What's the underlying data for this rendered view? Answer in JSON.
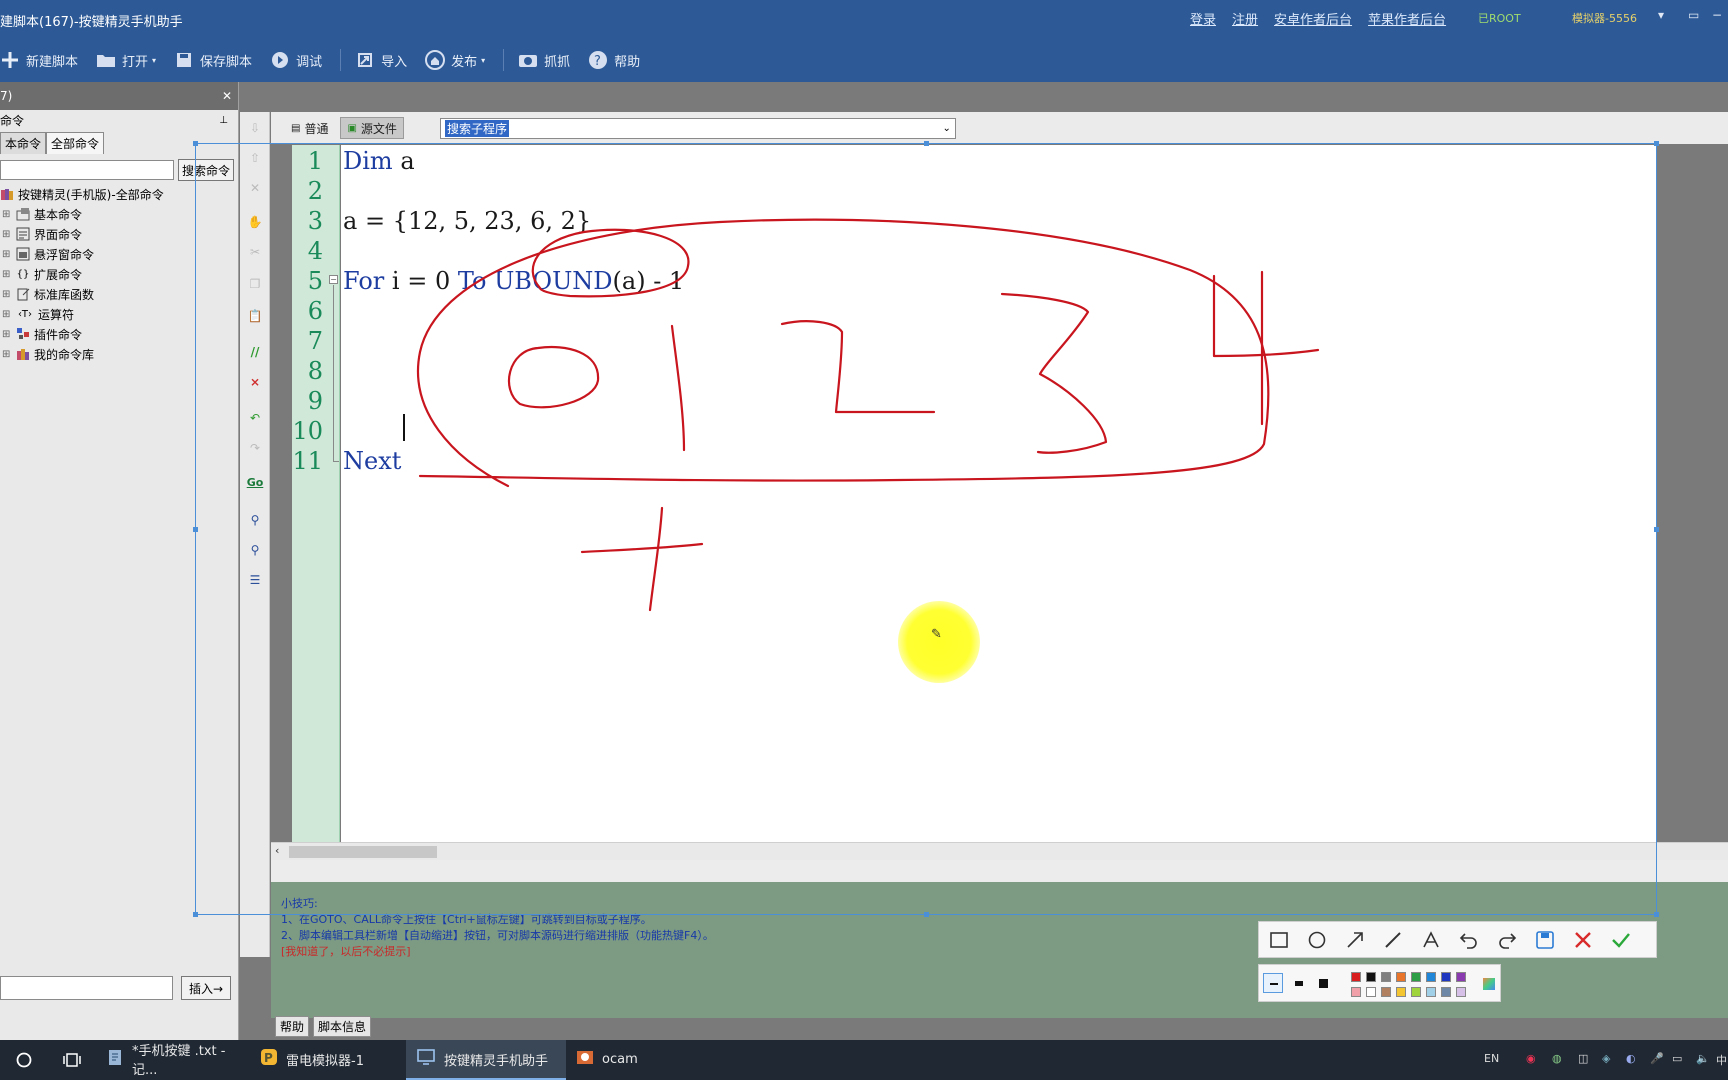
{
  "window": {
    "title": "建脚本(167)-按键精灵手机助手",
    "links": [
      "登录",
      "注册",
      "安卓作者后台",
      "苹果作者后台"
    ],
    "status": "已ROOT",
    "emulator": "模拟器-5556"
  },
  "toolbar": {
    "new": "新建脚本",
    "open": "打开",
    "save": "保存脚本",
    "debug": "调试",
    "import": "导入",
    "publish": "发布",
    "capture": "抓抓",
    "help": "帮助"
  },
  "left": {
    "tab_label": "7)",
    "header": "命令",
    "tabs": [
      "本命令",
      "全部命令"
    ],
    "search_button": "搜索命令",
    "tree": [
      {
        "label": "按键精灵(手机版)-全部命令",
        "icon": "books-icon"
      },
      {
        "label": "基本命令",
        "icon": "cmd-icon"
      },
      {
        "label": "界面命令",
        "icon": "ui-icon"
      },
      {
        "label": "悬浮窗命令",
        "icon": "window-icon"
      },
      {
        "label": "扩展命令",
        "icon": "braces-icon"
      },
      {
        "label": "标准库函数",
        "icon": "lib-icon"
      },
      {
        "label": "运算符",
        "icon": "operator-icon"
      },
      {
        "label": "插件命令",
        "icon": "plugin-icon"
      },
      {
        "label": "我的命令库",
        "icon": "mylib-icon"
      }
    ],
    "insert_button": "插入→"
  },
  "editor": {
    "mode_normal": "普通",
    "mode_source": "源文件",
    "sub_select": "搜索子程序",
    "line_numbers": [
      "1",
      "2",
      "3",
      "4",
      "5",
      "6",
      "7",
      "8",
      "9",
      "10",
      "11"
    ],
    "code": {
      "l1_kw": "Dim",
      "l1_rest": " a",
      "l3": "a = {12, 5, 23, 6, 2}",
      "l5_kw1": "For",
      "l5_mid": " i = 0 ",
      "l5_kw2": "To",
      "l5_sp": " ",
      "l5_kw3": "UBOUND",
      "l5_rest": "(a) - 1",
      "l11_kw": "Next"
    }
  },
  "tips": {
    "title": "小技巧:",
    "tip1": "1、在GOTO、CALL命令上按住【Ctrl+鼠标左键】可跳转到目标或子程序。",
    "tip2": "2、脚本编辑工具栏新增【自动缩进】按钮，可对脚本源码进行缩进排版（功能热键F4）。",
    "dismiss": "[我知道了，以后不必提示]"
  },
  "bottom_tabs": [
    "帮助",
    "脚本信息"
  ],
  "annotation_tools": [
    "rect-icon",
    "ellipse-icon",
    "arrow-icon",
    "pen-icon",
    "text-icon",
    "undo-icon",
    "redo-icon",
    "save-icon",
    "cancel-icon",
    "confirm-icon"
  ],
  "palette": {
    "row1": [
      "#d81e1e",
      "#111111",
      "#808080",
      "#e8752a",
      "#2e9e46",
      "#1f86d8",
      "#2038c0",
      "#8a3bb0"
    ],
    "row2": [
      "#f0a0a8",
      "#ffffff",
      "#b08060",
      "#f2c531",
      "#9fd43c",
      "#9fd0e8",
      "#6f87a6",
      "#d6c0e8"
    ]
  },
  "taskbar": {
    "apps": [
      {
        "label": "*手机按键 .txt - 记...",
        "icon": "notepad-icon"
      },
      {
        "label": "雷电模拟器-1",
        "icon": "ldplayer-icon"
      },
      {
        "label": "按键精灵手机助手",
        "icon": "anjian-icon"
      },
      {
        "label": "ocam",
        "icon": "ocam-icon"
      }
    ],
    "lang": "EN"
  },
  "colors": {
    "title_blue": "#2d5a97",
    "ink_red": "#c8151e",
    "gutter_green": "#cfe8d7"
  }
}
